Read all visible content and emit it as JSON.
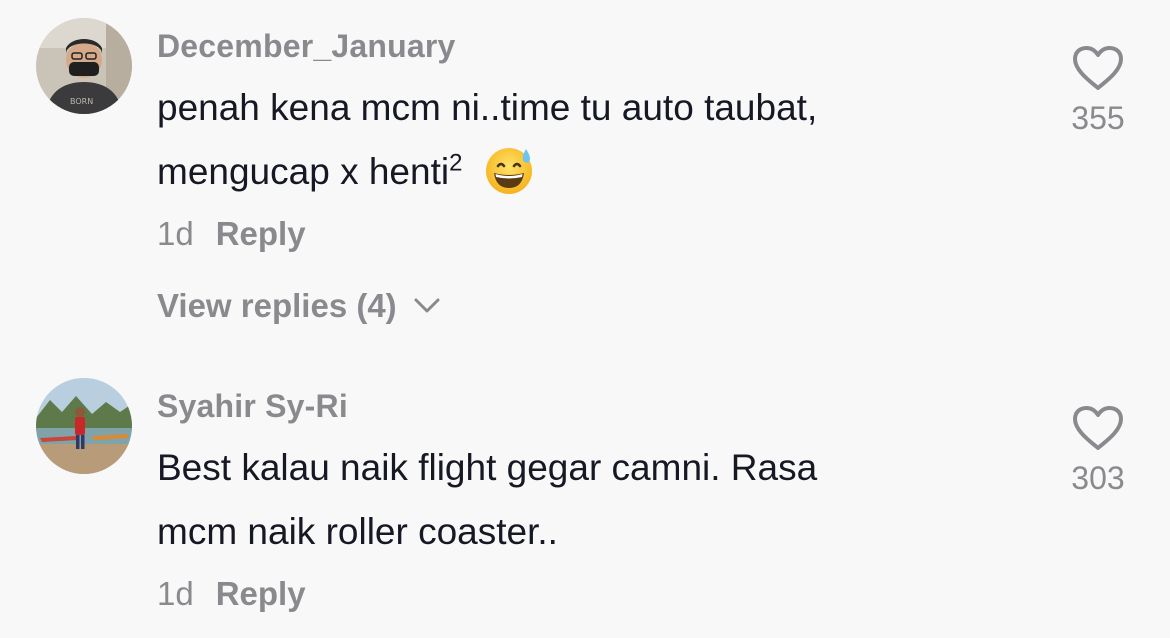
{
  "comments": [
    {
      "username": "December_January",
      "text_line1": "penah kena mcm ni..time tu auto taubat,",
      "text_line2_prefix": "mengucap x henti",
      "text_line2_superscript": "2",
      "emoji": "grinning-face-with-sweat",
      "time": "1d",
      "reply_label": "Reply",
      "view_replies_label": "View replies (4)",
      "like_count": "355",
      "like_icon": "heart-outline-icon"
    },
    {
      "username": "Syahir Sy-Ri",
      "text_line1": "Best kalau naik flight gegar camni. Rasa",
      "text_line2": "mcm naik roller coaster..",
      "time": "1d",
      "reply_label": "Reply",
      "like_count": "303",
      "like_icon": "heart-outline-icon"
    }
  ],
  "colors": {
    "background": "#f8f8f8",
    "primary_text": "#161823",
    "secondary_text": "#8a8a8e"
  }
}
